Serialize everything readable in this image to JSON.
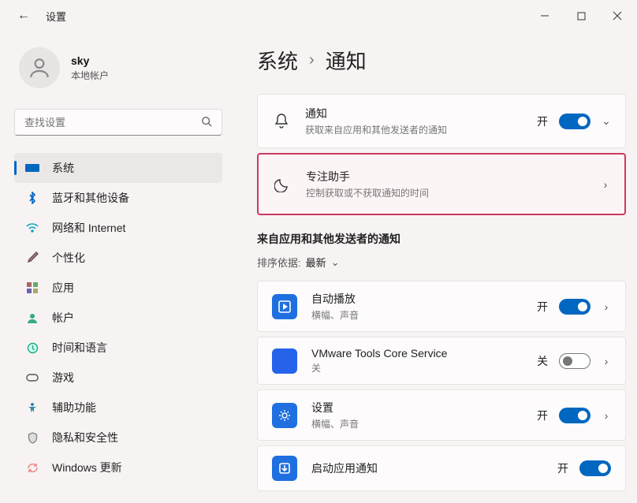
{
  "app": {
    "title": "设置"
  },
  "user": {
    "name": "sky",
    "type": "本地帐户"
  },
  "search": {
    "placeholder": "查找设置"
  },
  "sidebar": {
    "items": [
      {
        "label": "系统"
      },
      {
        "label": "蓝牙和其他设备"
      },
      {
        "label": "网络和 Internet"
      },
      {
        "label": "个性化"
      },
      {
        "label": "应用"
      },
      {
        "label": "帐户"
      },
      {
        "label": "时间和语言"
      },
      {
        "label": "游戏"
      },
      {
        "label": "辅助功能"
      },
      {
        "label": "隐私和安全性"
      },
      {
        "label": "Windows 更新"
      }
    ]
  },
  "breadcrumb": {
    "root": "系统",
    "current": "通知"
  },
  "cards": {
    "notifications": {
      "title": "通知",
      "sub": "获取来自应用和其他发送者的通知",
      "state": "开"
    },
    "focus": {
      "title": "专注助手",
      "sub": "控制获取或不获取通知的时间"
    }
  },
  "section": {
    "title": "来自应用和其他发送者的通知",
    "sort_label": "排序依据:",
    "sort_value": "最新"
  },
  "apps": [
    {
      "title": "自动播放",
      "sub": "横幅、声音",
      "state": "开",
      "toggle": "on"
    },
    {
      "title": "VMware Tools Core Service",
      "sub": "关",
      "state": "关",
      "toggle": "off"
    },
    {
      "title": "设置",
      "sub": "横幅、声音",
      "state": "开",
      "toggle": "on"
    },
    {
      "title": "启动应用通知",
      "sub": "",
      "state": "开",
      "toggle": "on"
    }
  ]
}
